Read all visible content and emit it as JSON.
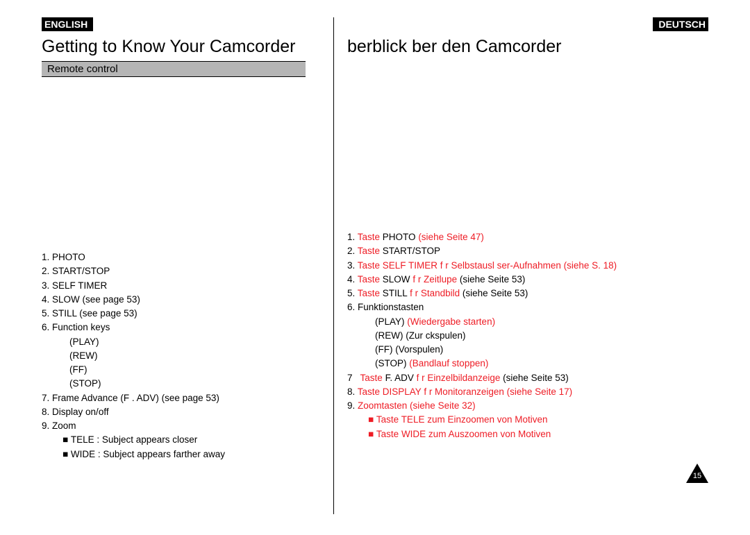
{
  "page_number": "15",
  "left": {
    "lang": "ENGLISH",
    "heading": "Getting to Know Your Camcorder",
    "subheading": "Remote control",
    "items": [
      {
        "num": "1.",
        "text": "PHOTO"
      },
      {
        "num": "2.",
        "text": "START/STOP"
      },
      {
        "num": "3.",
        "text": "SELF TIMER"
      },
      {
        "num": "4.",
        "text": "SLOW (see page 53)"
      },
      {
        "num": "5.",
        "text": "STILL (see page 53)"
      },
      {
        "num": "6.",
        "text": "Function keys"
      }
    ],
    "fn_keys": [
      "(PLAY)",
      "(REW)",
      "(FF)",
      "(STOP)"
    ],
    "items2": [
      {
        "num": "7.",
        "text": "Frame Advance (F . ADV) (see page 53)"
      },
      {
        "num": "8.",
        "text": "Display on/off"
      },
      {
        "num": "9.",
        "text": "Zoom"
      }
    ],
    "zoom": [
      "TELE : Subject appears closer",
      "WIDE : Subject appears farther away"
    ]
  },
  "right": {
    "lang": "DEUTSCH",
    "heading": "berblick  ber den Camcorder",
    "items": {
      "l1_pre": "Taste ",
      "l1_mid": "PHOTO ",
      "l1_post": "(siehe Seite 47)",
      "l2_pre": "Taste ",
      "l2_mid": "START/STOP",
      "l3": "Taste SELF TIMER f r Selbstausl ser-Aufnahmen (siehe S. 18)",
      "l4_pre": "Taste ",
      "l4_mid": "SLOW ",
      "l4_red": "f r Zeitlupe ",
      "l4_post": "   (siehe Seite 53)",
      "l5_pre": "Taste ",
      "l5_mid": "STILL ",
      "l5_red": "f r Standbild ",
      "l5_post": "  (siehe Seite 53)",
      "l6": "Funktionstasten",
      "fk1_a": "(PLAY) ",
      "fk1_b": "(Wiedergabe starten)",
      "fk2": "(REW) (Zur ckspulen)",
      "fk3": "(FF) (Vorspulen)",
      "fk4_a": "(STOP) ",
      "fk4_b": "(Bandlauf stoppen)",
      "l7_pre": "Taste ",
      "l7_mid1": "F. ADV ",
      "l7_red": "f r Einzelbildanzeige ",
      "l7_post": "    (siehe Seite 53)",
      "l8": "Taste DISPLAY f r Monitoranzeigen (siehe Seite 17)",
      "l9": "Zoomtasten (siehe Seite 32)",
      "z1_pre": "Taste ",
      "z1_rest": "TELE zum Einzoomen von Motiven",
      "z2_pre": "Taste ",
      "z2_rest": "WIDE zum Auszoomen von Motiven"
    }
  }
}
